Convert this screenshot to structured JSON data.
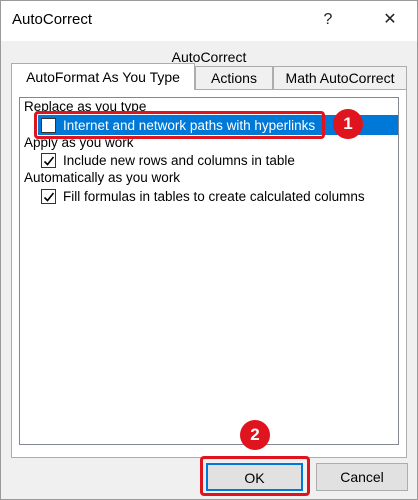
{
  "window": {
    "title": "AutoCorrect",
    "help_icon": "?",
    "close_icon": "✕"
  },
  "section_label": "AutoCorrect",
  "tabs": [
    {
      "label": "AutoFormat As You Type",
      "active": true
    },
    {
      "label": "Actions",
      "active": false
    },
    {
      "label": "Math AutoCorrect",
      "active": false
    }
  ],
  "groups": {
    "replace": {
      "label": "Replace as you type",
      "items": [
        {
          "label": "Internet and network paths with hyperlinks",
          "checked": false,
          "selected": true
        }
      ]
    },
    "apply": {
      "label": "Apply as you work",
      "items": [
        {
          "label": "Include new rows and columns in table",
          "checked": true
        }
      ]
    },
    "auto": {
      "label": "Automatically as you work",
      "items": [
        {
          "label": "Fill formulas in tables to create calculated columns",
          "checked": true
        }
      ]
    }
  },
  "callouts": {
    "step1": "1",
    "step2": "2",
    "color": "#e0141e"
  },
  "buttons": {
    "ok": "OK",
    "cancel": "Cancel"
  },
  "colors": {
    "selection": "#0078d7",
    "dialog_bg": "#f0f0f0"
  }
}
